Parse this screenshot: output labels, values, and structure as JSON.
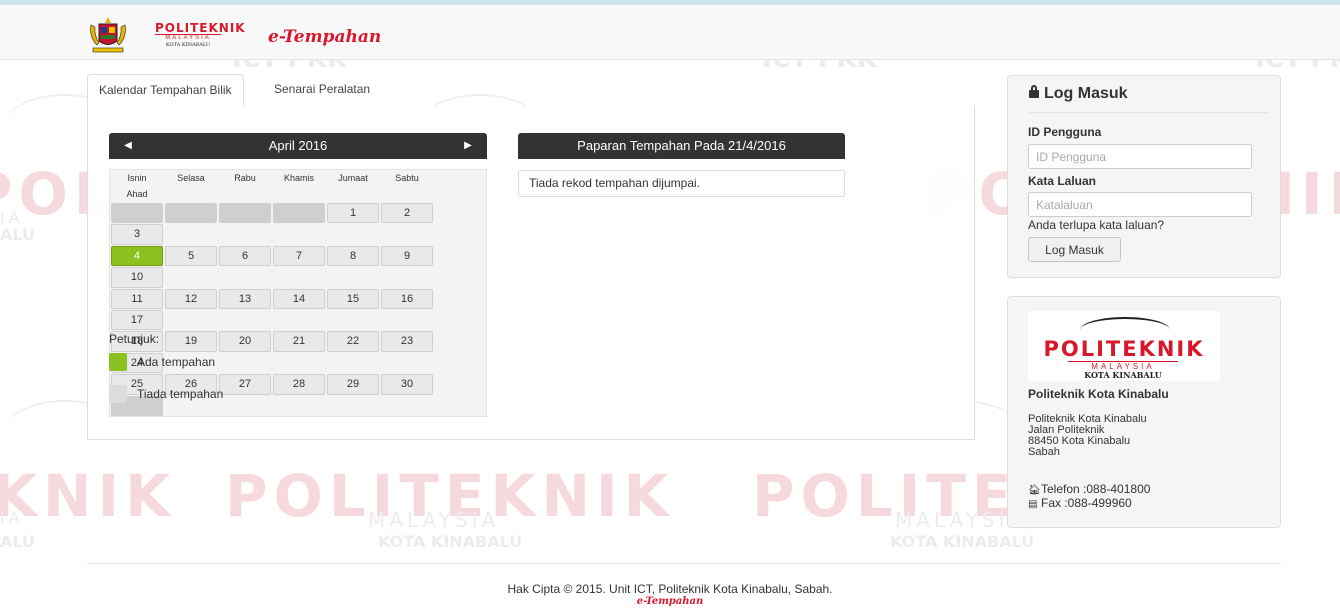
{
  "header": {
    "logo_text": "POLITEKNIK",
    "logo_sub": "MALAYSIA",
    "logo_campus": "KOTA KINABALU",
    "app_title": "e-Tempahan"
  },
  "watermark": {
    "brand": "POLITEKNIK",
    "country": "MALAYSIA",
    "campus": "KOTA KINABALU",
    "ict": "ICT PKK",
    "partial_left": "KNIK",
    "partial_mid": "ALU",
    "partial_ia": "IA"
  },
  "tabs": [
    {
      "label": "Kalendar Tempahan Bilik",
      "active": true
    },
    {
      "label": "Senarai Peralatan",
      "active": false
    }
  ],
  "calendar": {
    "month_label": "April 2016",
    "prev_icon": "triangle-left-icon",
    "next_icon": "triangle-right-icon",
    "weekdays": [
      "Isnin",
      "Selasa",
      "Rabu",
      "Khamis",
      "Jumaat",
      "Sabtu",
      "Ahad"
    ],
    "weeks": [
      [
        "",
        "",
        "",
        "",
        "1",
        "2",
        "3"
      ],
      [
        "4",
        "5",
        "6",
        "7",
        "8",
        "9",
        "10"
      ],
      [
        "11",
        "12",
        "13",
        "14",
        "15",
        "16",
        "17"
      ],
      [
        "18",
        "19",
        "20",
        "21",
        "22",
        "23",
        "24"
      ],
      [
        "25",
        "26",
        "27",
        "28",
        "29",
        "30",
        ""
      ]
    ],
    "booked_days": [
      "4"
    ]
  },
  "legend": {
    "title": "Petunjuk:",
    "items": [
      {
        "label": "Ada tempahan",
        "color": "#8cc11f"
      },
      {
        "label": "Tiada tempahan",
        "color": "#dcdcdc"
      }
    ]
  },
  "booking_view": {
    "title": "Paparan Tempahan Pada 21/4/2016",
    "empty_message": "Tiada rekod tempahan dijumpai."
  },
  "login": {
    "title": "Log Masuk",
    "title_icon": "lock-icon",
    "user_label": "ID Pengguna",
    "user_placeholder": "ID Pengguna",
    "password_label": "Kata Laluan",
    "password_placeholder": "Katalaluan",
    "forgot_link": "Anda terlupa kata laluan?",
    "submit_label": "Log Masuk"
  },
  "institution": {
    "logo_text": "POLITEKNIK",
    "logo_sub": "MALAYSIA",
    "logo_campus": "KOTA KINABALU",
    "name": "Politeknik Kota Kinabalu",
    "address_lines": [
      "Politeknik Kota Kinabalu",
      "Jalan Politeknik",
      "88450 Kota Kinabalu",
      "Sabah"
    ],
    "phone": "Telefon :088-401800",
    "fax": "Fax :088-499960",
    "phone_icon": "home-icon",
    "fax_icon": "printer-icon"
  },
  "footer": {
    "copyright": "Hak Cipta © 2015. Unit ICT, Politeknik Kota Kinabalu, Sabah.",
    "brand": "e-Tempahan"
  },
  "colors": {
    "accent_red": "#d9172a",
    "header_dark": "#333333",
    "booked_green": "#8cc11f"
  }
}
